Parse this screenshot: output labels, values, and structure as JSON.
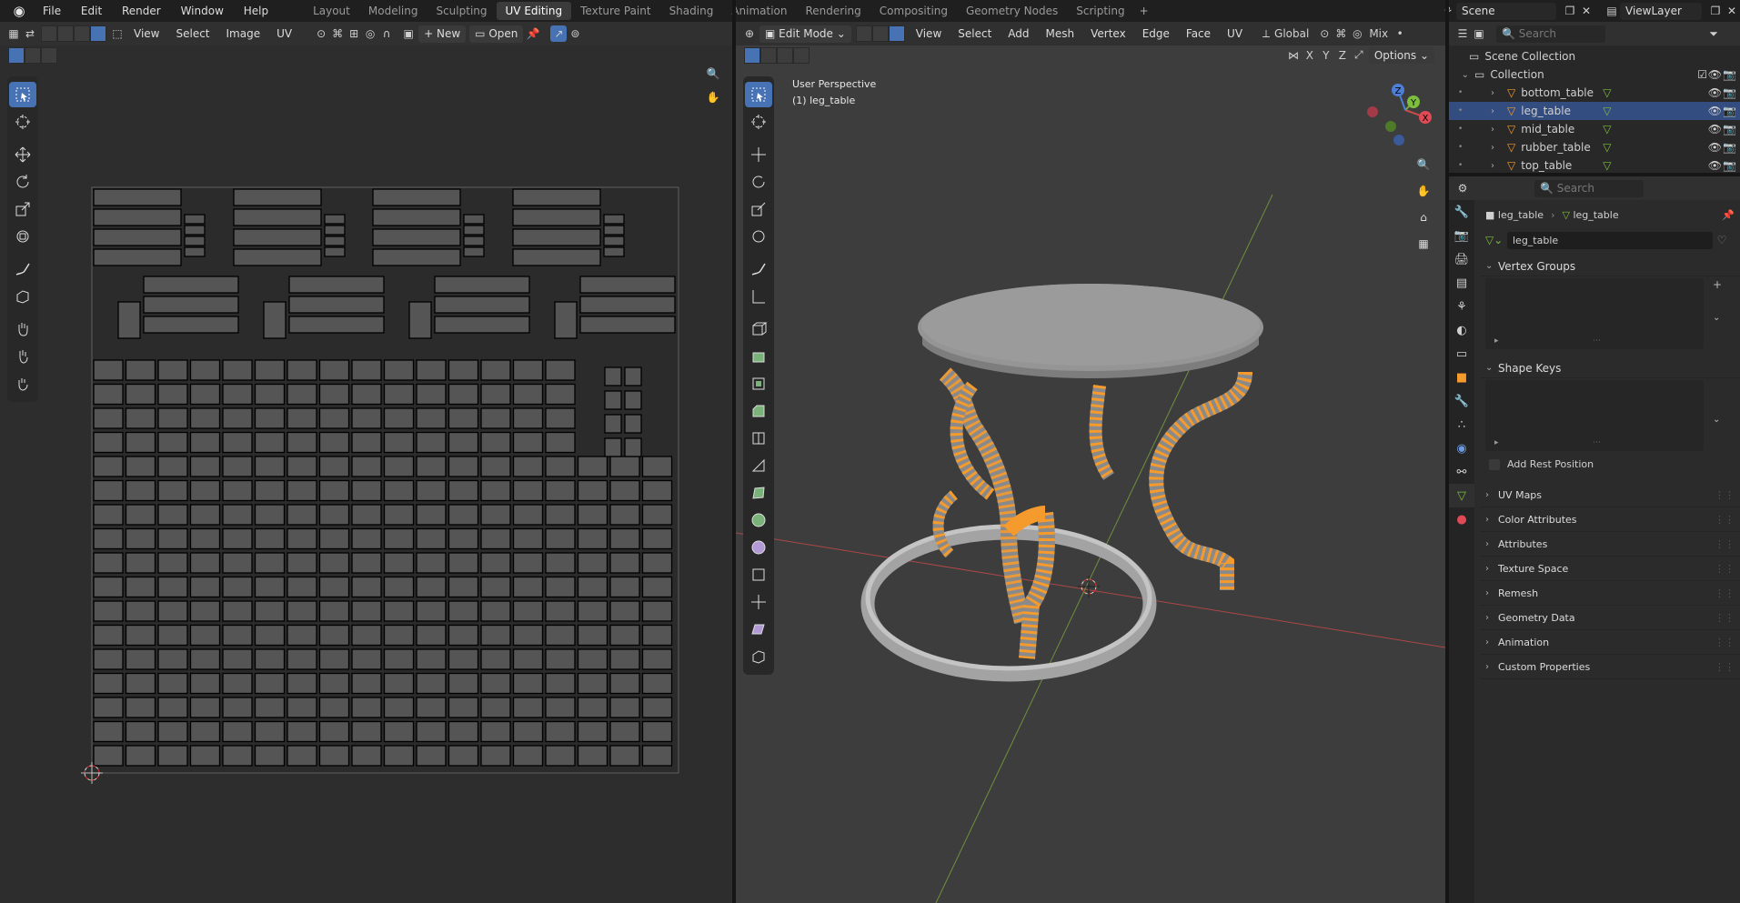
{
  "topbar": {
    "menu": [
      "File",
      "Edit",
      "Render",
      "Window",
      "Help"
    ],
    "workspaces": [
      "Layout",
      "Modeling",
      "Sculpting",
      "UV Editing",
      "Texture Paint",
      "Shading",
      "Animation",
      "Rendering",
      "Compositing",
      "Geometry Nodes",
      "Scripting"
    ],
    "active_workspace": "UV Editing",
    "scene": "Scene",
    "view_layer": "ViewLayer"
  },
  "uv_editor": {
    "menu": [
      "View",
      "Select",
      "Image",
      "UV"
    ],
    "new_label": "New",
    "open_label": "Open",
    "accent": "#4772b3"
  },
  "viewport": {
    "mode": "Edit Mode",
    "menu": [
      "View",
      "Select",
      "Add",
      "Mesh",
      "Vertex",
      "Edge",
      "Face",
      "UV"
    ],
    "orientation": "Global",
    "shading": "Mix",
    "options_label": "Options",
    "axes": [
      "X",
      "Y",
      "Z"
    ],
    "overlay_line1": "User Perspective",
    "overlay_line2": "(1) leg_table",
    "gizmo_axes": {
      "x": "X",
      "y": "Y",
      "z": "Z"
    },
    "colors": {
      "selection": "#f59a2c",
      "x_axis": "#c94a4a",
      "y_axis": "#7aa63c"
    }
  },
  "outliner": {
    "search_placeholder": "Search",
    "scene_collection": "Scene Collection",
    "collection": "Collection",
    "objects": [
      {
        "name": "bottom_table",
        "selected": false
      },
      {
        "name": "leg_table",
        "selected": true
      },
      {
        "name": "mid_table",
        "selected": false
      },
      {
        "name": "rubber_table",
        "selected": false
      },
      {
        "name": "top_table",
        "selected": false
      }
    ]
  },
  "properties": {
    "search_placeholder": "Search",
    "breadcrumb_object": "leg_table",
    "breadcrumb_data": "leg_table",
    "mesh_name": "leg_table",
    "vertex_groups": "Vertex Groups",
    "shape_keys": "Shape Keys",
    "add_rest_position": "Add Rest Position",
    "sections": [
      "UV Maps",
      "Color Attributes",
      "Attributes",
      "Texture Space",
      "Remesh",
      "Geometry Data",
      "Animation",
      "Custom Properties"
    ]
  }
}
